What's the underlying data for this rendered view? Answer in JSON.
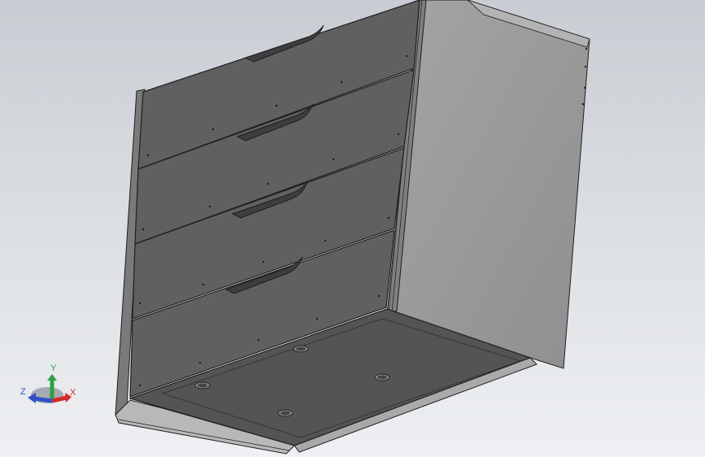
{
  "viewport": {
    "background_top": "#c9cdd3",
    "background_bottom": "#eef0f3"
  },
  "model": {
    "face_color": "#5f5f5f",
    "side_color": "#9b9b9b",
    "edge_color": "#1e1e1e",
    "drawer_count": 4
  },
  "triad": {
    "x_label": "X",
    "y_label": "Y",
    "z_label": "Z",
    "x_color": "#d22b2b",
    "y_color": "#2ea043",
    "z_color": "#2f4fc7"
  }
}
